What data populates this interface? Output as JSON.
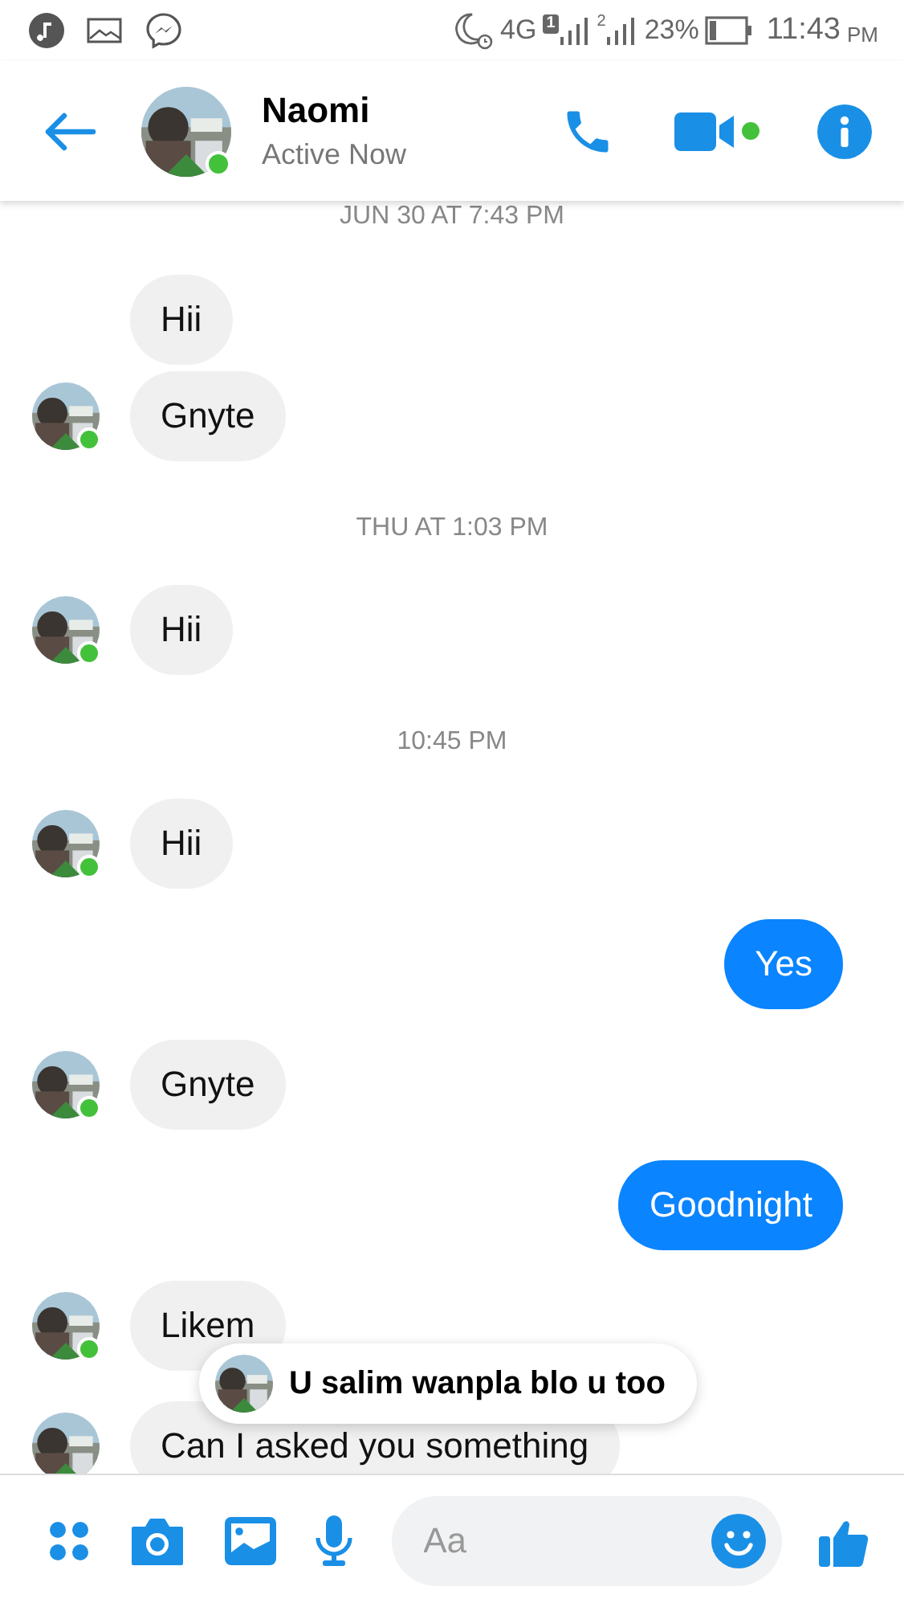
{
  "status_bar": {
    "network": "4G",
    "sim_1": "1",
    "sim_2": "2",
    "battery": "23%",
    "time": "11:43",
    "ampm": "PM"
  },
  "header": {
    "name": "Naomi",
    "status": "Active Now",
    "online": true,
    "video_active": true
  },
  "messages": [
    {
      "kind": "time",
      "text": "JUN 30 AT 7:43 PM"
    },
    {
      "kind": "in",
      "text": "Hii",
      "avatar": false
    },
    {
      "kind": "in",
      "text": "Gnyte",
      "avatar": true,
      "online": true
    },
    {
      "kind": "time",
      "text": "THU AT 1:03 PM"
    },
    {
      "kind": "in",
      "text": "Hii",
      "avatar": true,
      "online": true
    },
    {
      "kind": "time",
      "text": "10:45 PM"
    },
    {
      "kind": "in",
      "text": "Hii",
      "avatar": true,
      "online": true
    },
    {
      "kind": "out",
      "text": "Yes"
    },
    {
      "kind": "in",
      "text": "Gnyte",
      "avatar": true,
      "online": true
    },
    {
      "kind": "out",
      "text": "Goodnight"
    },
    {
      "kind": "in",
      "text": "Likem",
      "avatar": true,
      "online": true
    },
    {
      "kind": "in",
      "text": "Can I asked you something",
      "avatar": true,
      "online": false
    }
  ],
  "notification": {
    "text": "U salim wanpla blo u too"
  },
  "composer": {
    "placeholder": "Aa"
  }
}
